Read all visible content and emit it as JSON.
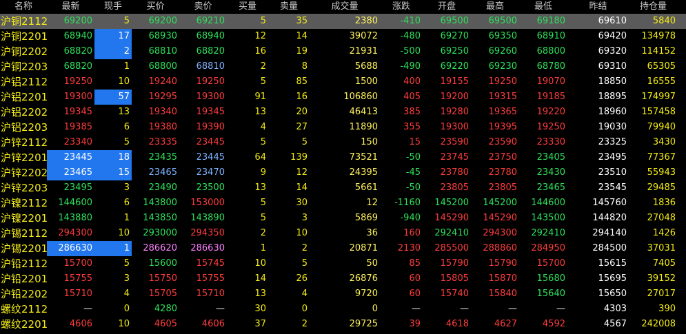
{
  "headers": [
    "名称",
    "最新",
    "现手",
    "买价",
    "卖价",
    "买量",
    "卖量",
    "成交量",
    "涨跌",
    "开盘",
    "最高",
    "最低",
    "昨结",
    "持仓量"
  ],
  "colors": {
    "up": "#ff3c3c",
    "down": "#2ee05a",
    "flat": "#ffffff",
    "name": "#f4ec16",
    "highlight": "#2277ee",
    "selected_row": "#5a5a5a"
  },
  "rows": [
    {
      "name": "沪铜2112",
      "last": "69200",
      "hand": "5",
      "bid": "69200",
      "ask": "69210",
      "bid_vol": "5",
      "ask_vol": "35",
      "volume": "2380",
      "change": "-410",
      "open": "69500",
      "high": "69500",
      "low": "69180",
      "prev": "69610",
      "oi": "5840",
      "selected": true
    },
    {
      "name": "沪铜2201",
      "last": "68940",
      "hand": "17",
      "bid": "68930",
      "ask": "68940",
      "bid_vol": "12",
      "ask_vol": "14",
      "volume": "39072",
      "change": "-480",
      "open": "69270",
      "high": "69350",
      "low": "68910",
      "prev": "69420",
      "oi": "134978"
    },
    {
      "name": "沪铜2202",
      "last": "68820",
      "hand": "2",
      "bid": "68810",
      "ask": "68820",
      "bid_vol": "16",
      "ask_vol": "19",
      "volume": "21931",
      "change": "-500",
      "open": "69250",
      "high": "69260",
      "low": "68800",
      "prev": "69320",
      "oi": "114152"
    },
    {
      "name": "沪铜2203",
      "last": "68820",
      "hand": "1",
      "bid": "68800",
      "ask": "68810",
      "bid_vol": "2",
      "ask_vol": "8",
      "volume": "5688",
      "change": "-490",
      "open": "69220",
      "high": "69230",
      "low": "68780",
      "prev": "69310",
      "oi": "65305"
    },
    {
      "name": "沪铝2112",
      "last": "19250",
      "hand": "10",
      "bid": "19240",
      "ask": "19250",
      "bid_vol": "5",
      "ask_vol": "85",
      "volume": "1500",
      "change": "400",
      "open": "19155",
      "high": "19250",
      "low": "19070",
      "prev": "18850",
      "oi": "16555"
    },
    {
      "name": "沪铝2201",
      "last": "19300",
      "hand": "57",
      "bid": "19295",
      "ask": "19300",
      "bid_vol": "91",
      "ask_vol": "16",
      "volume": "106860",
      "change": "405",
      "open": "19200",
      "high": "19315",
      "low": "19185",
      "prev": "18895",
      "oi": "174997"
    },
    {
      "name": "沪铝2202",
      "last": "19345",
      "hand": "13",
      "bid": "19340",
      "ask": "19345",
      "bid_vol": "13",
      "ask_vol": "20",
      "volume": "46413",
      "change": "385",
      "open": "19280",
      "high": "19365",
      "low": "19220",
      "prev": "18960",
      "oi": "157458"
    },
    {
      "name": "沪铝2203",
      "last": "19385",
      "hand": "6",
      "bid": "19380",
      "ask": "19390",
      "bid_vol": "4",
      "ask_vol": "27",
      "volume": "11890",
      "change": "355",
      "open": "19300",
      "high": "19395",
      "low": "19250",
      "prev": "19030",
      "oi": "79940"
    },
    {
      "name": "沪锌2112",
      "last": "23340",
      "hand": "5",
      "bid": "23335",
      "ask": "23445",
      "bid_vol": "5",
      "ask_vol": "5",
      "volume": "150",
      "change": "15",
      "open": "23590",
      "high": "23590",
      "low": "23330",
      "prev": "23325",
      "oi": "3430"
    },
    {
      "name": "沪锌2201",
      "last": "23445",
      "hand": "18",
      "bid": "23435",
      "ask": "23445",
      "bid_vol": "64",
      "ask_vol": "139",
      "volume": "73521",
      "change": "-50",
      "open": "23745",
      "high": "23750",
      "low": "23405",
      "prev": "23495",
      "oi": "77367"
    },
    {
      "name": "沪锌2202",
      "last": "23465",
      "hand": "15",
      "bid": "23465",
      "ask": "23470",
      "bid_vol": "9",
      "ask_vol": "12",
      "volume": "24395",
      "change": "-45",
      "open": "23780",
      "high": "23780",
      "low": "23430",
      "prev": "23510",
      "oi": "55943"
    },
    {
      "name": "沪锌2203",
      "last": "23495",
      "hand": "3",
      "bid": "23490",
      "ask": "23500",
      "bid_vol": "13",
      "ask_vol": "14",
      "volume": "5661",
      "change": "-50",
      "open": "23805",
      "high": "23805",
      "low": "23465",
      "prev": "23545",
      "oi": "29485"
    },
    {
      "name": "沪镍2112",
      "last": "144600",
      "hand": "6",
      "bid": "143800",
      "ask": "153000",
      "bid_vol": "5",
      "ask_vol": "30",
      "volume": "12",
      "change": "-1160",
      "open": "145200",
      "high": "145200",
      "low": "144600",
      "prev": "145760",
      "oi": "1836"
    },
    {
      "name": "沪镍2201",
      "last": "143880",
      "hand": "1",
      "bid": "143850",
      "ask": "143890",
      "bid_vol": "5",
      "ask_vol": "3",
      "volume": "5869",
      "change": "-940",
      "open": "145290",
      "high": "145290",
      "low": "143500",
      "prev": "144820",
      "oi": "27048"
    },
    {
      "name": "沪锡2112",
      "last": "294300",
      "hand": "10",
      "bid": "293000",
      "ask": "294350",
      "bid_vol": "2",
      "ask_vol": "10",
      "volume": "36",
      "change": "160",
      "open": "292410",
      "high": "294300",
      "low": "292410",
      "prev": "294140",
      "oi": "1426"
    },
    {
      "name": "沪锡2201",
      "last": "286630",
      "hand": "1",
      "bid": "286620",
      "ask": "286630",
      "bid_vol": "1",
      "ask_vol": "2",
      "volume": "20871",
      "change": "2130",
      "open": "285500",
      "high": "288860",
      "low": "284950",
      "prev": "284500",
      "oi": "37031"
    },
    {
      "name": "沪铅2112",
      "last": "15700",
      "hand": "5",
      "bid": "15600",
      "ask": "15745",
      "bid_vol": "10",
      "ask_vol": "5",
      "volume": "50",
      "change": "85",
      "open": "15790",
      "high": "15790",
      "low": "15700",
      "prev": "15615",
      "oi": "7405"
    },
    {
      "name": "沪铅2201",
      "last": "15755",
      "hand": "3",
      "bid": "15750",
      "ask": "15755",
      "bid_vol": "14",
      "ask_vol": "26",
      "volume": "26876",
      "change": "60",
      "open": "15805",
      "high": "15870",
      "low": "15680",
      "prev": "15695",
      "oi": "39152"
    },
    {
      "name": "沪铅2202",
      "last": "15710",
      "hand": "4",
      "bid": "15705",
      "ask": "15710",
      "bid_vol": "13",
      "ask_vol": "4",
      "volume": "9720",
      "change": "60",
      "open": "15740",
      "high": "15840",
      "low": "15640",
      "prev": "15650",
      "oi": "27017"
    },
    {
      "name": "螺纹2112",
      "last": "—",
      "hand": "0",
      "bid": "4280",
      "ask": "—",
      "bid_vol": "30",
      "ask_vol": "0",
      "volume": "0",
      "change": "—",
      "open": "—",
      "high": "—",
      "low": "—",
      "prev": "4303",
      "oi": "390"
    },
    {
      "name": "螺纹2201",
      "last": "4606",
      "hand": "10",
      "bid": "4605",
      "ask": "4606",
      "bid_vol": "37",
      "ask_vol": "2",
      "volume": "29725",
      "change": "39",
      "open": "4618",
      "high": "4627",
      "low": "4592",
      "prev": "4567",
      "oi": "242008"
    }
  ]
}
